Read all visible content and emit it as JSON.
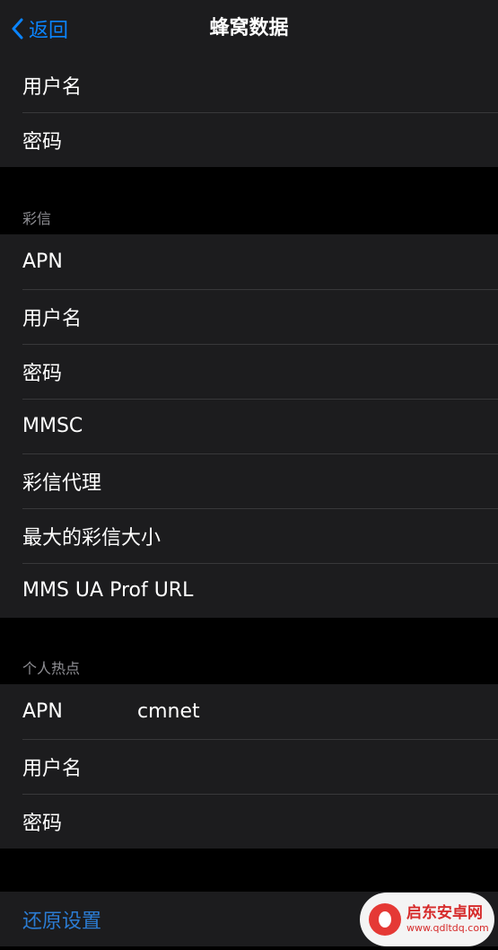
{
  "navbar": {
    "back_label": "返回",
    "title": "蜂窝数据"
  },
  "group_top": {
    "rows": [
      {
        "label": "用户名"
      },
      {
        "label": "密码"
      }
    ]
  },
  "mms": {
    "header": "彩信",
    "rows": [
      {
        "label": "APN"
      },
      {
        "label": "用户名"
      },
      {
        "label": "密码"
      },
      {
        "label": "MMSC"
      },
      {
        "label": "彩信代理"
      },
      {
        "label": "最大的彩信大小"
      },
      {
        "label": "MMS UA Prof URL"
      }
    ]
  },
  "hotspot": {
    "header": "个人热点",
    "rows": [
      {
        "label": "APN",
        "value": "cmnet"
      },
      {
        "label": "用户名"
      },
      {
        "label": "密码"
      }
    ]
  },
  "reset": {
    "label": "还原设置"
  },
  "watermark": {
    "name": "启东安卓网",
    "url": "www.qdltdq.com"
  },
  "colors": {
    "accent": "#0a84ff",
    "reset_text": "#2b7cd3",
    "background": "#000000",
    "cell_background": "#1c1c1e",
    "separator": "#38383a",
    "section_header": "#8e8e93"
  }
}
